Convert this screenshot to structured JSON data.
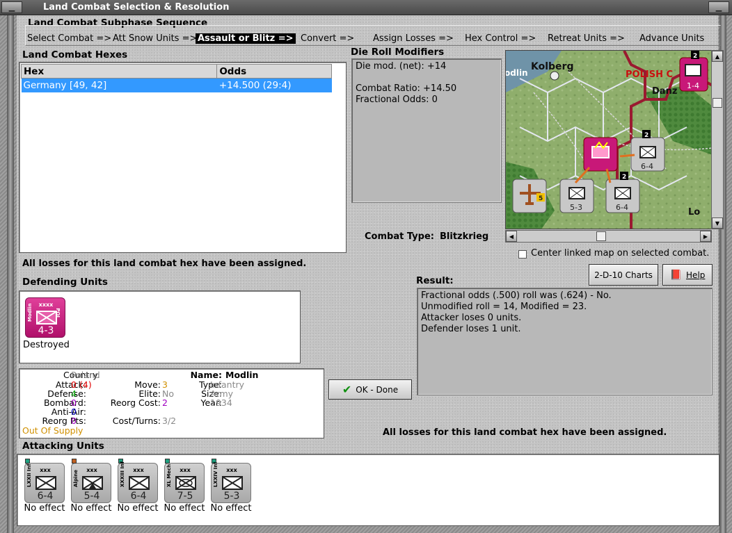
{
  "window": {
    "title": "Land Combat Selection & Resolution"
  },
  "subphase": {
    "header": "Land Combat Subphase Sequence",
    "steps": [
      "Select Combat =>",
      "Att Snow Units =>",
      "Assault or Blitz =>",
      "Convert =>",
      "Assign Losses =>",
      "Hex Control =>",
      "Retreat Units =>",
      "Advance Units"
    ],
    "active_index": 2
  },
  "hexes": {
    "header": "Land Combat Hexes",
    "columns": [
      "Hex",
      "Odds"
    ],
    "rows": [
      {
        "hex": "Germany [49, 42]",
        "odds": "+14.500 (29:4)"
      }
    ]
  },
  "modifiers": {
    "header": "Die Roll Modifiers",
    "net": "Die mod. (net): +14",
    "ratio": "Combat Ratio: +14.50",
    "fractional": "Fractional Odds: 0"
  },
  "combat_type": {
    "label": "Combat Type:",
    "value": "Blitzkrieg"
  },
  "map": {
    "labels": {
      "kolberg": "Kolberg",
      "modlin": "odlin",
      "polish": "POLISH C",
      "danz": "Danz",
      "lo": "Lo"
    },
    "center_linked": "Center linked map on selected combat.",
    "counters": [
      "6-4",
      "5-3",
      "6-4",
      "1-4",
      "5",
      "2",
      "2",
      "2"
    ]
  },
  "status_top": "All losses for this land combat hex have been assigned.",
  "defending": {
    "header": "Defending Units",
    "unit": {
      "name": "Modlin",
      "side": "POL",
      "size": "xxxx",
      "strength": "4-3",
      "status": "Destroyed"
    }
  },
  "details": {
    "country_label": "Country:",
    "country": "Poland",
    "attack_label": "Attack:",
    "attack": "0",
    "attack_mod": "(4)",
    "defense_label": "Defense:",
    "defense": "4",
    "bombard_label": "Bombard:",
    "bombard": "0",
    "antiair_label": "Anti-Air:",
    "antiair": "0",
    "reorgpts_label": "Reorg Pts:",
    "reorgpts": "0",
    "supply": "Out Of Supply",
    "move_label": "Move:",
    "move": "3",
    "elite_label": "Elite:",
    "elite": "No",
    "reorgcost_label": "Reorg Cost:",
    "reorgcost": "2",
    "costturns_label": "Cost/Turns:",
    "costturns": "3/2",
    "name_label": "Name:",
    "name": "Modlin",
    "type_label": "Type:",
    "type": "Infantry",
    "size_label": "Size:",
    "size": "Army",
    "year_label": "Year:",
    "year": "1934"
  },
  "buttons": {
    "charts": "2-D-10 Charts",
    "help": "Help",
    "ok": "OK - Done"
  },
  "result": {
    "header": "Result:",
    "lines": [
      "Fractional odds (.500) roll was (.624)  - No.",
      "Unmodified roll = 14, Modified = 23.",
      "Attacker loses 0 units.",
      "Defender loses 1 unit."
    ]
  },
  "status_bottom": "All losses for this land combat hex have been assigned.",
  "attacking": {
    "header": "Attacking Units",
    "units": [
      {
        "name": "LXXII Inf",
        "size": "xxx",
        "strength": "6-4",
        "status": "No effect"
      },
      {
        "name": "Alpine",
        "size": "xxx",
        "strength": "5-4",
        "status": "No effect"
      },
      {
        "name": "XXXIII Inf",
        "size": "xxx",
        "strength": "6-4",
        "status": "No effect"
      },
      {
        "name": "XL Mech",
        "size": "xxx",
        "strength": "7-5",
        "status": "No effect"
      },
      {
        "name": "LXXIV Inf",
        "size": "xxx",
        "strength": "5-3",
        "status": "No effect"
      }
    ]
  },
  "colors": {
    "accent": "#3399ff",
    "defender": "#c81878",
    "supply": "#d09000",
    "green": "#00a000",
    "red": "#e00000",
    "purple": "#a000c0",
    "blue": "#0000c0"
  }
}
